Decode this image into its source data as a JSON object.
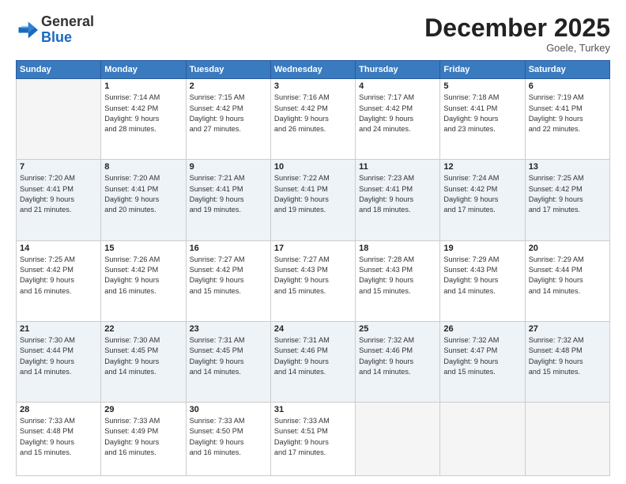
{
  "header": {
    "logo_general": "General",
    "logo_blue": "Blue",
    "month_title": "December 2025",
    "location": "Goele, Turkey"
  },
  "weekdays": [
    "Sunday",
    "Monday",
    "Tuesday",
    "Wednesday",
    "Thursday",
    "Friday",
    "Saturday"
  ],
  "weeks": [
    [
      {
        "day": "",
        "info": ""
      },
      {
        "day": "1",
        "info": "Sunrise: 7:14 AM\nSunset: 4:42 PM\nDaylight: 9 hours\nand 28 minutes."
      },
      {
        "day": "2",
        "info": "Sunrise: 7:15 AM\nSunset: 4:42 PM\nDaylight: 9 hours\nand 27 minutes."
      },
      {
        "day": "3",
        "info": "Sunrise: 7:16 AM\nSunset: 4:42 PM\nDaylight: 9 hours\nand 26 minutes."
      },
      {
        "day": "4",
        "info": "Sunrise: 7:17 AM\nSunset: 4:42 PM\nDaylight: 9 hours\nand 24 minutes."
      },
      {
        "day": "5",
        "info": "Sunrise: 7:18 AM\nSunset: 4:41 PM\nDaylight: 9 hours\nand 23 minutes."
      },
      {
        "day": "6",
        "info": "Sunrise: 7:19 AM\nSunset: 4:41 PM\nDaylight: 9 hours\nand 22 minutes."
      }
    ],
    [
      {
        "day": "7",
        "info": "Sunrise: 7:20 AM\nSunset: 4:41 PM\nDaylight: 9 hours\nand 21 minutes."
      },
      {
        "day": "8",
        "info": "Sunrise: 7:20 AM\nSunset: 4:41 PM\nDaylight: 9 hours\nand 20 minutes."
      },
      {
        "day": "9",
        "info": "Sunrise: 7:21 AM\nSunset: 4:41 PM\nDaylight: 9 hours\nand 19 minutes."
      },
      {
        "day": "10",
        "info": "Sunrise: 7:22 AM\nSunset: 4:41 PM\nDaylight: 9 hours\nand 19 minutes."
      },
      {
        "day": "11",
        "info": "Sunrise: 7:23 AM\nSunset: 4:41 PM\nDaylight: 9 hours\nand 18 minutes."
      },
      {
        "day": "12",
        "info": "Sunrise: 7:24 AM\nSunset: 4:42 PM\nDaylight: 9 hours\nand 17 minutes."
      },
      {
        "day": "13",
        "info": "Sunrise: 7:25 AM\nSunset: 4:42 PM\nDaylight: 9 hours\nand 17 minutes."
      }
    ],
    [
      {
        "day": "14",
        "info": "Sunrise: 7:25 AM\nSunset: 4:42 PM\nDaylight: 9 hours\nand 16 minutes."
      },
      {
        "day": "15",
        "info": "Sunrise: 7:26 AM\nSunset: 4:42 PM\nDaylight: 9 hours\nand 16 minutes."
      },
      {
        "day": "16",
        "info": "Sunrise: 7:27 AM\nSunset: 4:42 PM\nDaylight: 9 hours\nand 15 minutes."
      },
      {
        "day": "17",
        "info": "Sunrise: 7:27 AM\nSunset: 4:43 PM\nDaylight: 9 hours\nand 15 minutes."
      },
      {
        "day": "18",
        "info": "Sunrise: 7:28 AM\nSunset: 4:43 PM\nDaylight: 9 hours\nand 15 minutes."
      },
      {
        "day": "19",
        "info": "Sunrise: 7:29 AM\nSunset: 4:43 PM\nDaylight: 9 hours\nand 14 minutes."
      },
      {
        "day": "20",
        "info": "Sunrise: 7:29 AM\nSunset: 4:44 PM\nDaylight: 9 hours\nand 14 minutes."
      }
    ],
    [
      {
        "day": "21",
        "info": "Sunrise: 7:30 AM\nSunset: 4:44 PM\nDaylight: 9 hours\nand 14 minutes."
      },
      {
        "day": "22",
        "info": "Sunrise: 7:30 AM\nSunset: 4:45 PM\nDaylight: 9 hours\nand 14 minutes."
      },
      {
        "day": "23",
        "info": "Sunrise: 7:31 AM\nSunset: 4:45 PM\nDaylight: 9 hours\nand 14 minutes."
      },
      {
        "day": "24",
        "info": "Sunrise: 7:31 AM\nSunset: 4:46 PM\nDaylight: 9 hours\nand 14 minutes."
      },
      {
        "day": "25",
        "info": "Sunrise: 7:32 AM\nSunset: 4:46 PM\nDaylight: 9 hours\nand 14 minutes."
      },
      {
        "day": "26",
        "info": "Sunrise: 7:32 AM\nSunset: 4:47 PM\nDaylight: 9 hours\nand 15 minutes."
      },
      {
        "day": "27",
        "info": "Sunrise: 7:32 AM\nSunset: 4:48 PM\nDaylight: 9 hours\nand 15 minutes."
      }
    ],
    [
      {
        "day": "28",
        "info": "Sunrise: 7:33 AM\nSunset: 4:48 PM\nDaylight: 9 hours\nand 15 minutes."
      },
      {
        "day": "29",
        "info": "Sunrise: 7:33 AM\nSunset: 4:49 PM\nDaylight: 9 hours\nand 16 minutes."
      },
      {
        "day": "30",
        "info": "Sunrise: 7:33 AM\nSunset: 4:50 PM\nDaylight: 9 hours\nand 16 minutes."
      },
      {
        "day": "31",
        "info": "Sunrise: 7:33 AM\nSunset: 4:51 PM\nDaylight: 9 hours\nand 17 minutes."
      },
      {
        "day": "",
        "info": ""
      },
      {
        "day": "",
        "info": ""
      },
      {
        "day": "",
        "info": ""
      }
    ]
  ]
}
